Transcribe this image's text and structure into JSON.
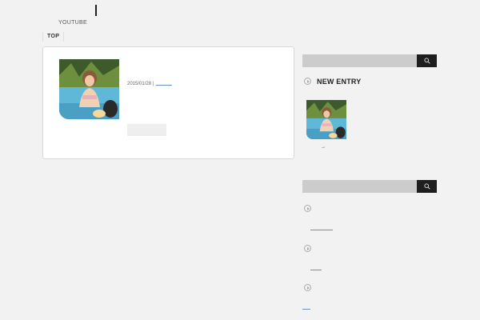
{
  "header": {
    "subtitle": "YOUTUBE"
  },
  "breadcrumb": {
    "label": "TOP"
  },
  "post": {
    "date": "2015/01/28",
    "separator": "|"
  },
  "sidebar": {
    "new_entry_title": "NEW ENTRY",
    "arrow_text": "→"
  },
  "icons": {
    "search": "search-icon",
    "widget": "play-circle-icon"
  },
  "colors": {
    "background": "#f2f2f2",
    "search_bar": "#cccccc",
    "search_button": "#1e1e1e",
    "link": "#6b8fbf"
  }
}
